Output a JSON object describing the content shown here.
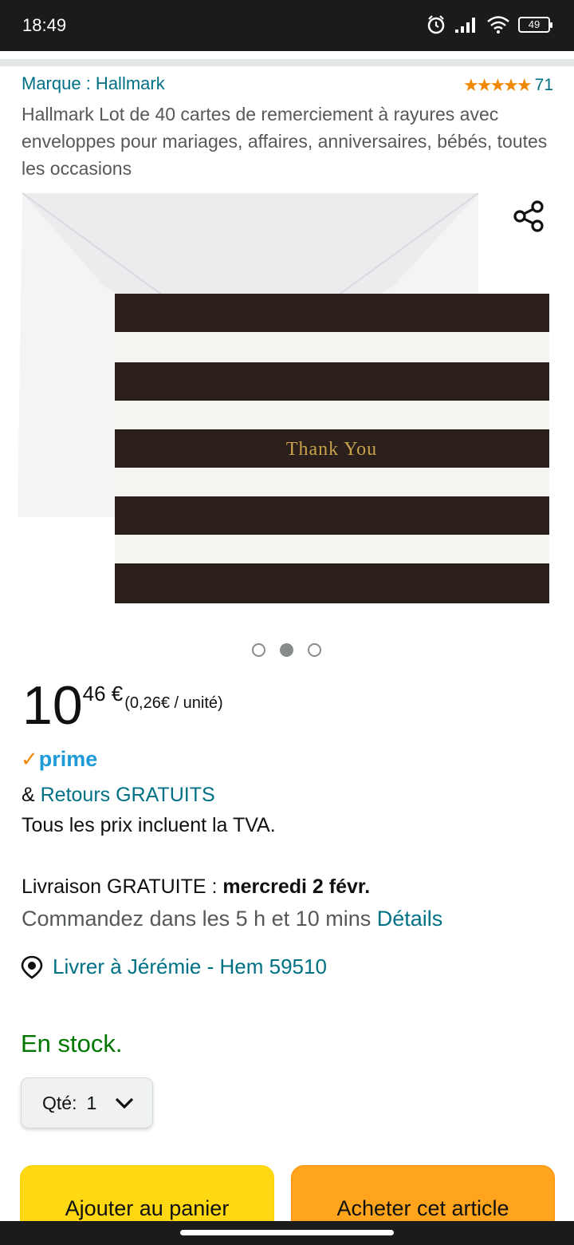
{
  "status_bar": {
    "time": "18:49",
    "battery": "49"
  },
  "product": {
    "brand": "Marque : Hallmark",
    "rating_count": "71",
    "title": "Hallmark Lot de 40 cartes de remerciement à rayures avec enveloppes pour mariages, affaires, anniversaires, bébés, toutes les occasions",
    "card_text": "Thank You",
    "image_count": 3,
    "active_image": 2
  },
  "price": {
    "whole": "10",
    "fraction": "46 €",
    "unit_price": "(0,26€ / unité)"
  },
  "prime": {
    "label": "prime"
  },
  "returns": {
    "prefix": "& ",
    "link": "Retours GRATUITS"
  },
  "vat_note": "Tous les prix incluent la TVA.",
  "delivery": {
    "label": "Livraison GRATUITE : ",
    "date": "mercredi 2 févr.",
    "order_by": "Commandez dans les 5 h et 10 mins ",
    "details_link": "Détails",
    "deliver_to": "Livrer à Jérémie - Hem 59510"
  },
  "stock": "En stock.",
  "quantity": {
    "label": "Qté:",
    "value": "1"
  },
  "buttons": {
    "add_to_cart": "Ajouter au panier",
    "buy_now": "Acheter cet article"
  },
  "colors": {
    "link": "#007185",
    "star": "#f08804",
    "in_stock": "#007600",
    "cart_button": "#ffd814",
    "buy_button": "#ffa41c",
    "prime_blue": "#1f9bd7"
  }
}
